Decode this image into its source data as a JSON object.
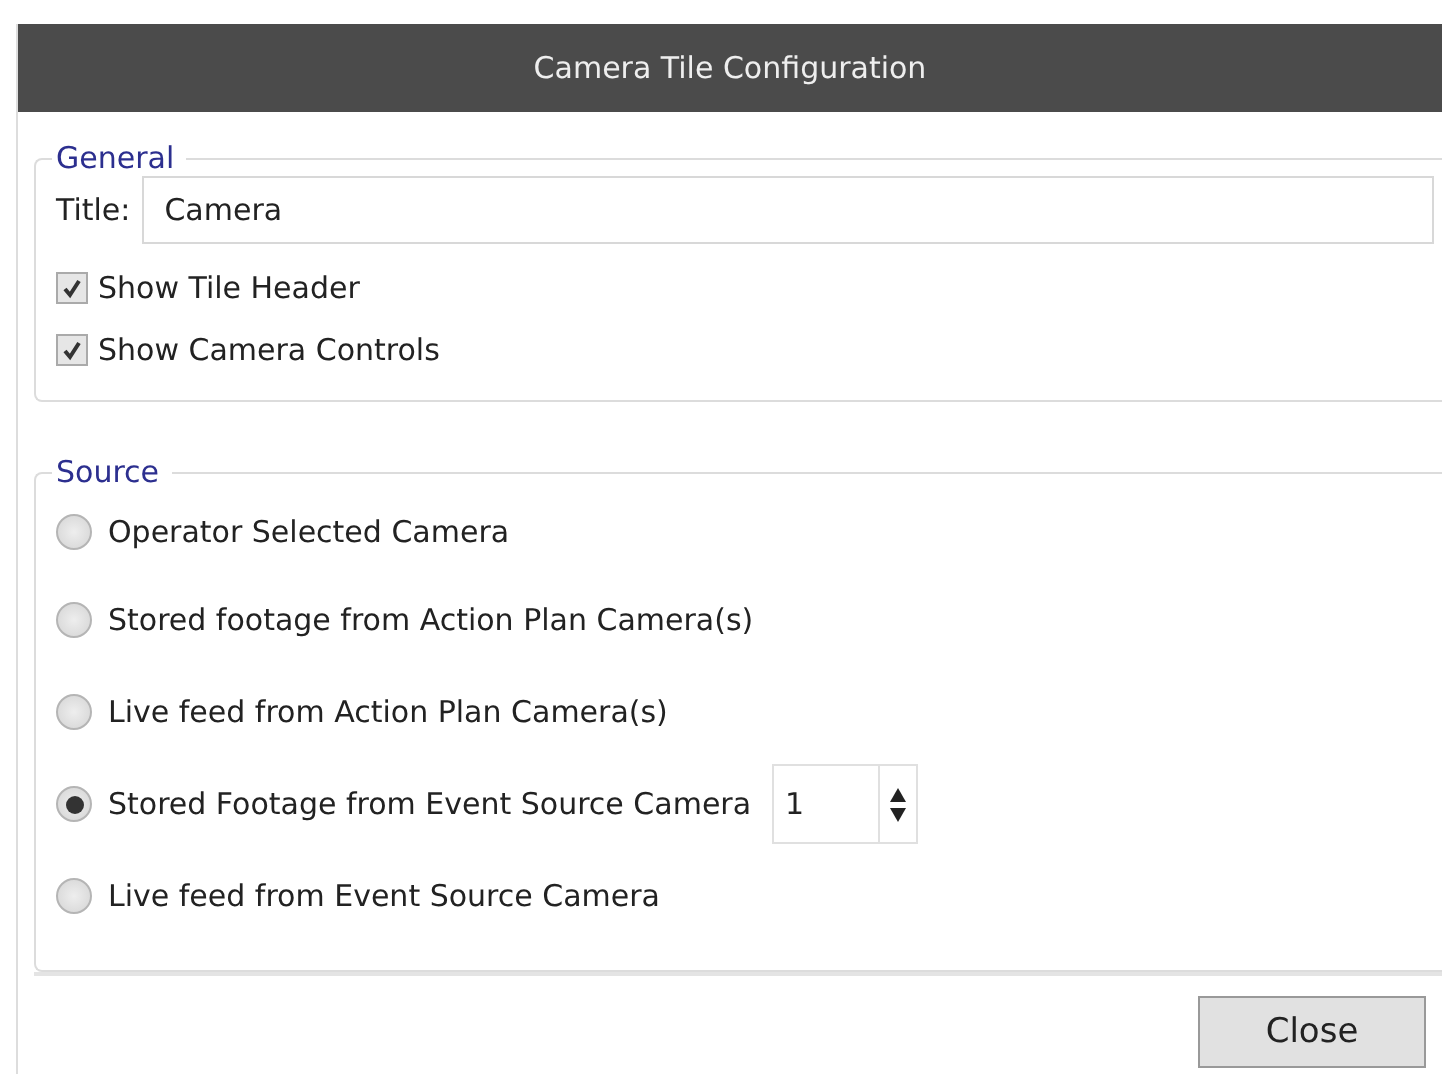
{
  "window": {
    "title": "Camera Tile Configuration"
  },
  "general": {
    "legend": "General",
    "title_label": "Title:",
    "title_value": "Camera",
    "checkboxes": [
      {
        "label": "Show Tile Header",
        "checked": true
      },
      {
        "label": "Show Camera Controls",
        "checked": true
      }
    ]
  },
  "source": {
    "legend": "Source",
    "options": [
      {
        "label": "Operator Selected Camera",
        "selected": false
      },
      {
        "label": "Stored footage from Action Plan Camera(s)",
        "selected": false
      },
      {
        "label": "Live feed from Action Plan Camera(s)",
        "selected": false
      },
      {
        "label": "Stored Footage from Event Source Camera",
        "selected": true,
        "spinner_value": "1"
      },
      {
        "label": "Live feed from Event Source Camera",
        "selected": false
      }
    ]
  },
  "buttons": [
    "Close"
  ]
}
